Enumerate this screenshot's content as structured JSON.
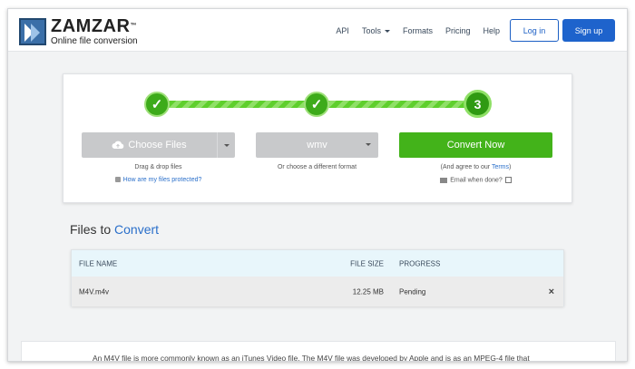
{
  "brand": {
    "name": "ZAMZAR",
    "trademark": "™",
    "tagline": "Online file conversion"
  },
  "nav": {
    "items": [
      "API",
      "Tools",
      "Formats",
      "Pricing",
      "Help"
    ],
    "login": "Log in",
    "signup": "Sign up"
  },
  "steps": {
    "step1": "✓",
    "step2": "✓",
    "step3": "3"
  },
  "converter": {
    "choose_files": "Choose Files",
    "drag_hint": "Drag & drop files",
    "protect_link": "How are my files protected?",
    "format_value": "wmv",
    "format_hint": "Or choose a different format",
    "convert_label": "Convert Now",
    "agree_prefix": "(And agree to our ",
    "terms_link": "Terms",
    "agree_suffix": ")",
    "email_label": "Email when done?"
  },
  "files": {
    "title_prefix": "Files to ",
    "title_accent": "Convert",
    "columns": {
      "name": "FILE NAME",
      "size": "FILE SIZE",
      "progress": "PROGRESS"
    },
    "rows": [
      {
        "name": "M4V.m4v",
        "size": "12.25 MB",
        "progress": "Pending",
        "remove": "×"
      }
    ]
  },
  "description": {
    "text": "An M4V file is more commonly known as an iTunes Video file. The M4V file was developed by Apple and is as an MPEG-4 file that"
  },
  "colors": {
    "accent_blue": "#1e63cc",
    "success_green": "#43b31a",
    "disabled_grey": "#c8c9cb"
  }
}
